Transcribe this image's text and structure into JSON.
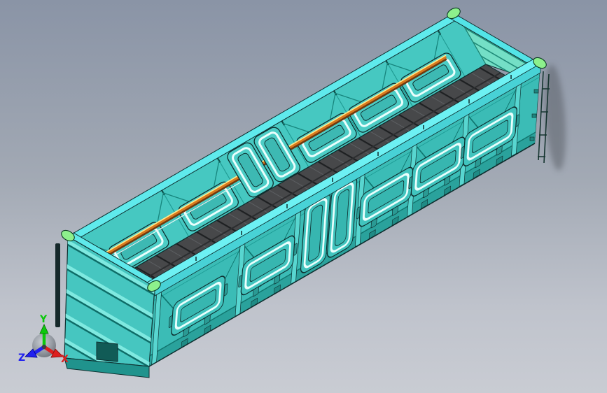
{
  "viewport": {
    "type": "3D CAD viewport",
    "model": "open-top gondola freight wagon",
    "background_top": "#8a94a6",
    "background_bottom": "#c9ccd3"
  },
  "palette": {
    "body_teal": "#3bbcb6",
    "interior_teal": "#46c8c1",
    "rim_cyan": "#5feaec",
    "end_wall_mint": "#74dfc6",
    "floor_gray": "#47484a",
    "handrail_orange": "#d9781c",
    "handrail_highlight": "#ffe98a",
    "corner_cap_green": "#8df08c",
    "edge_color": "#0e2e2e"
  },
  "axis_triad": {
    "x": {
      "label": "X",
      "color": "#dd1f1f"
    },
    "y": {
      "label": "Y",
      "color": "#0cc80c"
    },
    "z": {
      "label": "Z",
      "color": "#2121f0"
    }
  }
}
